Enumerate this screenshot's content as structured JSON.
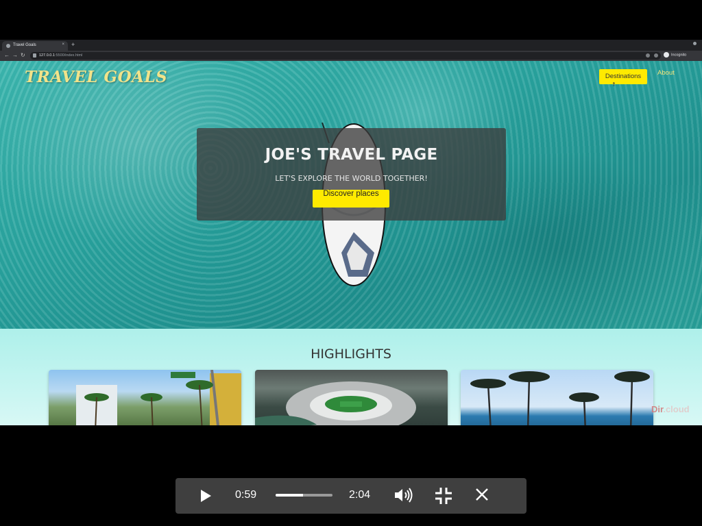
{
  "browser": {
    "tab_title": "Travel Goals",
    "tab_close": "×",
    "new_tab": "+",
    "url_host": "127.0.0.1",
    "url_path": ":5500/index.html",
    "profile_label": "Incognito"
  },
  "site": {
    "logo": "TRAVEL GOALS",
    "nav": {
      "destinations": "Destinations",
      "about": "About"
    },
    "hero": {
      "title": "JOE'S TRAVEL PAGE",
      "subtitle": "LET'S EXPLORE THE WORLD TOGETHER!",
      "cta": "Discover places"
    },
    "highlights": {
      "title": "HIGHLIGHTS",
      "cards": [
        {
          "image": "city-street-palms"
        },
        {
          "image": "stadium-aerial"
        },
        {
          "image": "beach-palms"
        }
      ]
    }
  },
  "watermark": {
    "brand": "Dir",
    "suffix": ".cloud"
  },
  "player": {
    "current_time": "0:59",
    "total_time": "2:04",
    "progress": 0.476,
    "icons": [
      "play-icon",
      "volume-icon",
      "exit-fullscreen-icon",
      "close-icon"
    ]
  },
  "colors": {
    "accent_yellow": "#ffea00",
    "logo_gold": "#f1e38a",
    "highlights_bg": "#aef0ea"
  }
}
